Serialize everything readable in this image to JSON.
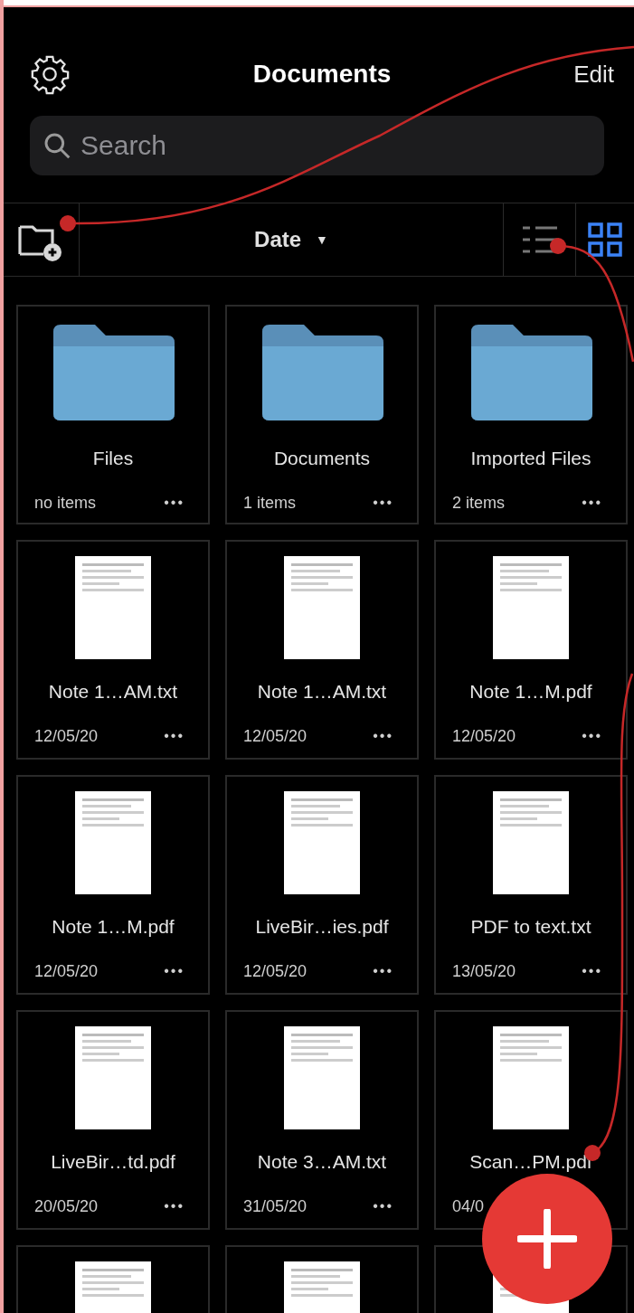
{
  "header": {
    "title": "Documents",
    "edit": "Edit"
  },
  "search": {
    "placeholder": "Search"
  },
  "toolbar": {
    "sort": "Date",
    "sort_arrow": "▼",
    "view_modes": [
      {
        "kind": "list",
        "selected": false
      },
      {
        "kind": "grid",
        "selected": true
      }
    ]
  },
  "items": [
    {
      "kind": "folder",
      "name": "Files",
      "detail": "no items",
      "more": "•••"
    },
    {
      "kind": "folder",
      "name": "Documents",
      "detail": "1 items",
      "more": "•••"
    },
    {
      "kind": "folder",
      "name": "Imported Files",
      "detail": "2 items",
      "more": "•••"
    },
    {
      "kind": "file",
      "name": "Note 1…AM.txt",
      "detail": "12/05/20",
      "more": "•••"
    },
    {
      "kind": "file",
      "name": "Note 1…AM.txt",
      "detail": "12/05/20",
      "more": "•••"
    },
    {
      "kind": "file",
      "name": "Note 1…M.pdf",
      "detail": "12/05/20",
      "more": "•••"
    },
    {
      "kind": "file",
      "name": "Note 1…M.pdf",
      "detail": "12/05/20",
      "more": "•••"
    },
    {
      "kind": "file",
      "name": "LiveBir…ies.pdf",
      "detail": "12/05/20",
      "more": "•••"
    },
    {
      "kind": "file",
      "name": "PDF to text.txt",
      "detail": "13/05/20",
      "more": "•••"
    },
    {
      "kind": "file",
      "name": "LiveBir…td.pdf",
      "detail": "20/05/20",
      "more": "•••"
    },
    {
      "kind": "file",
      "name": "Note 3…AM.txt",
      "detail": "31/05/20",
      "more": "•••"
    },
    {
      "kind": "file",
      "name": "Scan…PM.pdf",
      "detail": "04/0"
    },
    {
      "kind": "file"
    },
    {
      "kind": "file"
    },
    {
      "kind": "file"
    }
  ]
}
